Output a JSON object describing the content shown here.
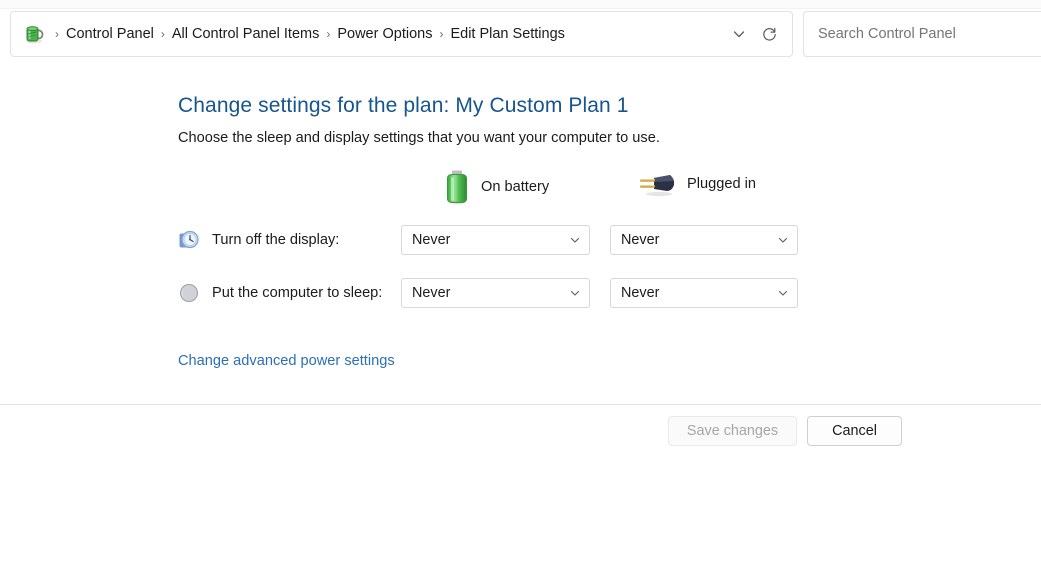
{
  "window": {
    "address_bar": {
      "icon": "power-options-icon",
      "breadcrumbs": [
        {
          "label": "Control Panel"
        },
        {
          "label": "All Control Panel Items"
        },
        {
          "label": "Power Options"
        },
        {
          "label": "Edit Plan Settings"
        }
      ],
      "separator": "›",
      "dropdown_icon": "chevron-down-icon",
      "refresh_icon": "refresh-icon"
    },
    "search": {
      "placeholder": "Search Control Panel",
      "value": "",
      "icon": "search-icon"
    }
  },
  "main": {
    "title": "Change settings for the plan: My Custom Plan 1",
    "subtitle": "Choose the sleep and display settings that you want your computer to use.",
    "columns": [
      {
        "id": "on-battery",
        "label": "On battery",
        "icon": "battery-icon"
      },
      {
        "id": "plugged-in",
        "label": "Plugged in",
        "icon": "power-plug-icon"
      }
    ],
    "settings_rows": [
      {
        "id": "turn-off-display",
        "label": "Turn off the display:",
        "icon": "display-clock-icon",
        "on_battery": "Never",
        "plugged_in": "Never"
      },
      {
        "id": "put-computer-to-sleep",
        "label": "Put the computer to sleep:",
        "icon": "sleep-moon-icon",
        "on_battery": "Never",
        "plugged_in": "Never"
      }
    ],
    "advanced_link": "Change advanced power settings"
  },
  "footer": {
    "save_label": "Save changes",
    "save_enabled": false,
    "cancel_label": "Cancel",
    "cancel_enabled": true
  },
  "colors": {
    "title_blue": "#16558f",
    "link_blue": "#2a6fb8",
    "battery_green": "#4fbc4f",
    "text": "#1b1b1b",
    "border": "#e2e2e2",
    "disabled_text": "#a6a6a6"
  }
}
